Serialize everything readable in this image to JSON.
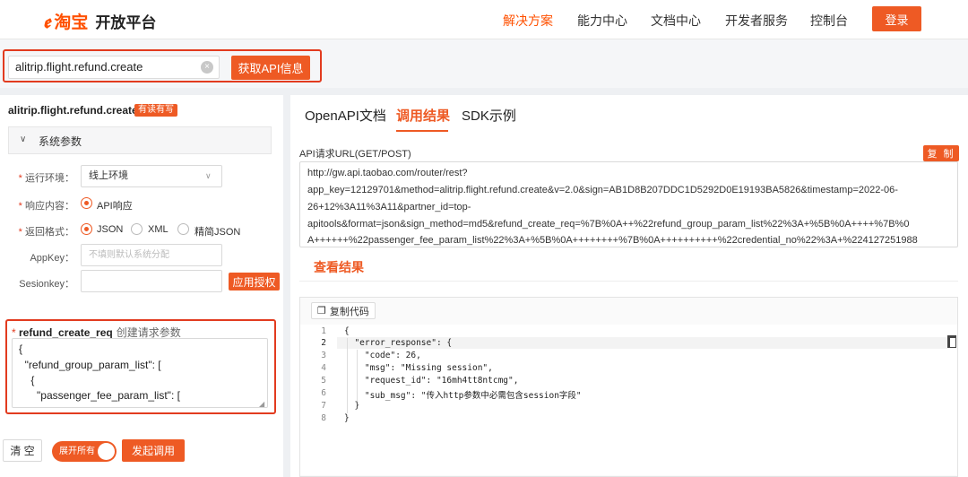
{
  "header": {
    "logo_mark": "А",
    "logo_taobao": "淘宝",
    "logo_platform": "开放平台",
    "nav": [
      "解决方案",
      "能力中心",
      "文档中心",
      "开发者服务",
      "控制台"
    ],
    "login": "登录"
  },
  "search": {
    "value": "alitrip.flight.refund.create",
    "button": "获取API信息"
  },
  "left": {
    "api_name": "alitrip.flight.refund.create",
    "tag": "有读有写",
    "system_params": "系统参数",
    "env_label": "运行环境：",
    "env_value": "线上环境",
    "resp_label": "响应内容：",
    "resp_option": "API响应",
    "format_label": "返回格式：",
    "format_options": [
      "JSON",
      "XML",
      "精简JSON"
    ],
    "appkey_label": "AppKey：",
    "appkey_placeholder": "不填则默认系统分配",
    "session_label": "Sesionkey：",
    "auth_button": "应用授权",
    "req_name": "refund_create_req",
    "req_desc": "创建请求参数",
    "req_lines": [
      "{",
      "  \"refund_group_param_list\": [",
      "    {",
      "      \"passenger_fee_param_list\": ["
    ],
    "clear_button": "清 空",
    "expand_toggle": "展开所有",
    "call_button": "发起调用"
  },
  "right": {
    "tabs": [
      "OpenAPI文档",
      "调用结果",
      "SDK示例"
    ],
    "url_label": "API请求URL(GET/POST)",
    "copy_button": "复 制",
    "url_lines": [
      "http://gw.api.taobao.com/router/rest?",
      "app_key=12129701&method=alitrip.flight.refund.create&v=2.0&sign=AB1D8B207DDC1D5292D0E19193BA5826&timestamp=2022-06-",
      "26+12%3A11%3A11&partner_id=top-",
      "apitools&format=json&sign_method=md5&refund_create_req=%7B%0A++%22refund_group_param_list%22%3A+%5B%0A++++%7B%0",
      "A++++++%22passenger_fee_param_list%22%3A+%5B%0A++++++++%7B%0A++++++++++%22credential_no%22%3A+%224127251988"
    ],
    "result_title": "查看结果",
    "copy_code": "复制代码",
    "code_lines": [
      "{",
      "  \"error_response\": {",
      "    \"code\": 26,",
      "    \"msg\": \"Missing session\",",
      "    \"request_id\": \"16mh4tt8ntcmg\",",
      "    \"sub_msg\": \"传入http参数中必需包含session字段\"",
      "  }",
      "}"
    ],
    "line_numbers": [
      "1",
      "2",
      "3",
      "4",
      "5",
      "6",
      "7",
      "8"
    ]
  },
  "colors": {
    "accent": "#ee5a24",
    "highlight": "#e23b1f"
  }
}
